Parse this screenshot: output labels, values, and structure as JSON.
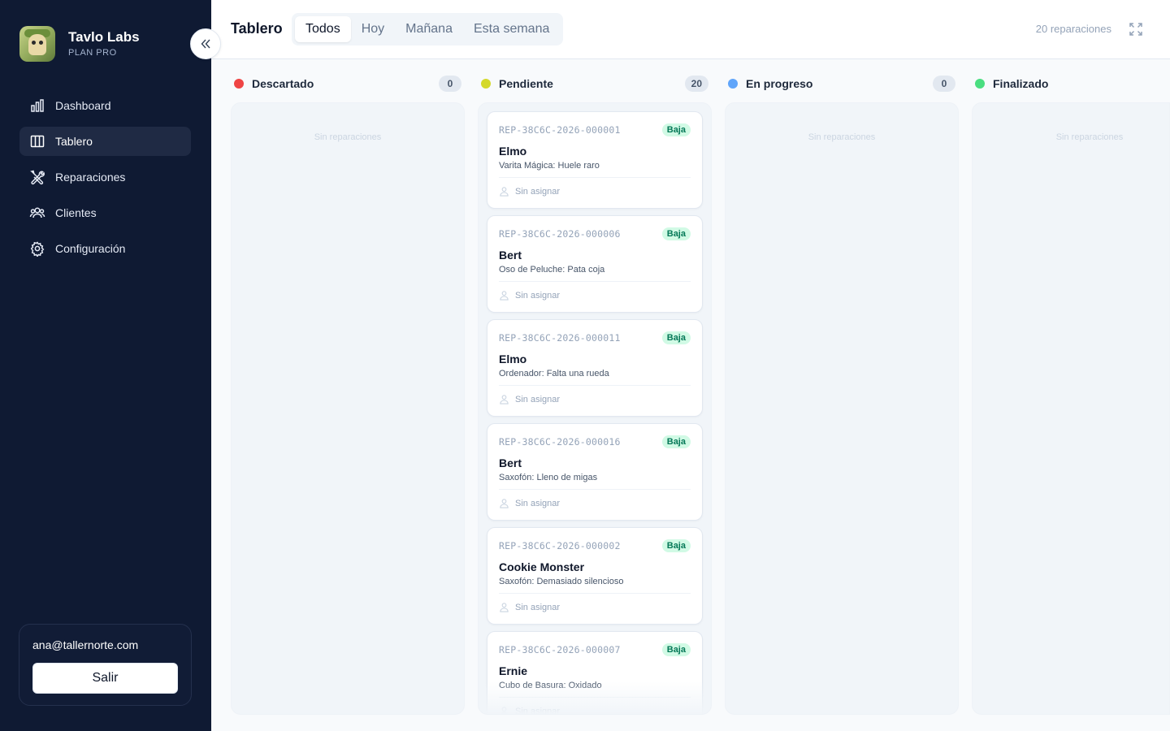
{
  "app": {
    "brand_name": "Tavlo Labs",
    "plan": "PLAN PRO"
  },
  "sidebar": {
    "items": [
      {
        "label": "Dashboard",
        "icon": "bar-chart-icon",
        "active": false
      },
      {
        "label": "Tablero",
        "icon": "columns-icon",
        "active": true
      },
      {
        "label": "Reparaciones",
        "icon": "tools-icon",
        "active": false
      },
      {
        "label": "Clientes",
        "icon": "users-icon",
        "active": false
      },
      {
        "label": "Configuración",
        "icon": "gear-icon",
        "active": false
      }
    ],
    "account": {
      "email": "ana@tallernorte.com",
      "logout_label": "Salir"
    }
  },
  "header": {
    "title": "Tablero",
    "tabs": [
      {
        "label": "Todos",
        "active": true
      },
      {
        "label": "Hoy",
        "active": false
      },
      {
        "label": "Mañana",
        "active": false
      },
      {
        "label": "Esta semana",
        "active": false
      }
    ],
    "count_text": "20 reparaciones"
  },
  "colors": {
    "descartado": "#ef4444",
    "pendiente": "#d4d92a",
    "en_progreso": "#60a5fa",
    "finalizado": "#4ade80"
  },
  "columns": [
    {
      "title": "Descartado",
      "count": "0",
      "empty_text": "Sin reparaciones"
    },
    {
      "title": "Pendiente",
      "count": "20",
      "empty_text": ""
    },
    {
      "title": "En progreso",
      "count": "0",
      "empty_text": "Sin reparaciones"
    },
    {
      "title": "Finalizado",
      "count": "",
      "empty_text": "Sin reparaciones"
    }
  ],
  "cards": [
    {
      "id": "REP-38C6C-2026-000001",
      "priority": "Baja",
      "name": "Elmo",
      "desc": "Varita Mágica: Huele raro",
      "assignee": "Sin asignar"
    },
    {
      "id": "REP-38C6C-2026-000006",
      "priority": "Baja",
      "name": "Bert",
      "desc": "Oso de Peluche: Pata coja",
      "assignee": "Sin asignar"
    },
    {
      "id": "REP-38C6C-2026-000011",
      "priority": "Baja",
      "name": "Elmo",
      "desc": "Ordenador: Falta una rueda",
      "assignee": "Sin asignar"
    },
    {
      "id": "REP-38C6C-2026-000016",
      "priority": "Baja",
      "name": "Bert",
      "desc": "Saxofón: Lleno de migas",
      "assignee": "Sin asignar"
    },
    {
      "id": "REP-38C6C-2026-000002",
      "priority": "Baja",
      "name": "Cookie Monster",
      "desc": "Saxofón: Demasiado silencioso",
      "assignee": "Sin asignar"
    },
    {
      "id": "REP-38C6C-2026-000007",
      "priority": "Baja",
      "name": "Ernie",
      "desc": "Cubo de Basura: Oxidado",
      "assignee": "Sin asignar"
    }
  ]
}
